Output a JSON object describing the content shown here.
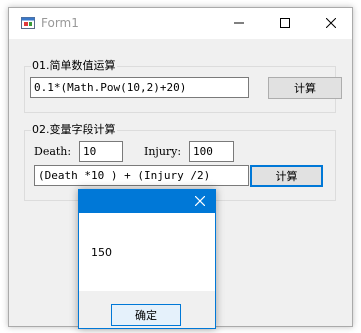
{
  "window": {
    "title": "Form1"
  },
  "group1": {
    "legend": "01.简单数值运算",
    "expression": "0.1*(Math.Pow(10,2)+20)",
    "button_label": "计算"
  },
  "group2": {
    "legend": "02.变量字段计算",
    "death_label": "Death:",
    "death_value": "10",
    "injury_label": "Injury:",
    "injury_value": "100",
    "expression": "(Death *10 ) + (Injury /2)",
    "button_label": "计算"
  },
  "message_box": {
    "text": "150",
    "ok_label": "确定"
  },
  "colors": {
    "accent": "#0078d7",
    "client_bg": "#f0f0f0",
    "button_bg": "#e1e1e1"
  },
  "icons": {
    "app": "form-window-icon",
    "minimize": "minimize-icon",
    "maximize": "maximize-icon",
    "close": "close-icon",
    "dialog_close": "close-icon"
  }
}
